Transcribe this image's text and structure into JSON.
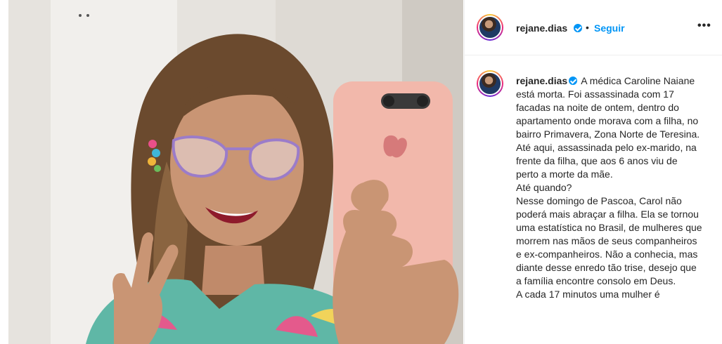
{
  "post": {
    "username": "rejane.dias",
    "separator": "•",
    "follow_label": "Seguir",
    "more_label": "•••"
  },
  "caption": {
    "username": "rejane.dias",
    "paragraphs": [
      "A médica Caroline Naiane está morta. Foi assassinada com 17 facadas na noite de ontem, dentro do apartamento onde morava com a filha, no bairro Primavera, Zona Norte de Teresina.",
      "Até aqui, assassinada pelo ex-marido, na frente da filha, que aos 6 anos viu de perto a morte da mãe.",
      "Até quando?",
      "Nesse domingo de Pascoa, Carol não poderá mais abraçar a filha. Ela se tornou uma estatística no Brasil, de mulheres que morrem nas mãos de seus companheiros e ex-companheiros. Não a conhecia, mas diante desse enredo tão trise, desejo que a família encontre consolo em Deus.",
      "A cada 17 minutos uma mulher é"
    ]
  },
  "icons": {
    "verified": "verified-badge-icon",
    "more": "more-options-icon"
  },
  "colors": {
    "link_blue": "#0095f6",
    "text": "#262626",
    "border": "#efefef"
  }
}
